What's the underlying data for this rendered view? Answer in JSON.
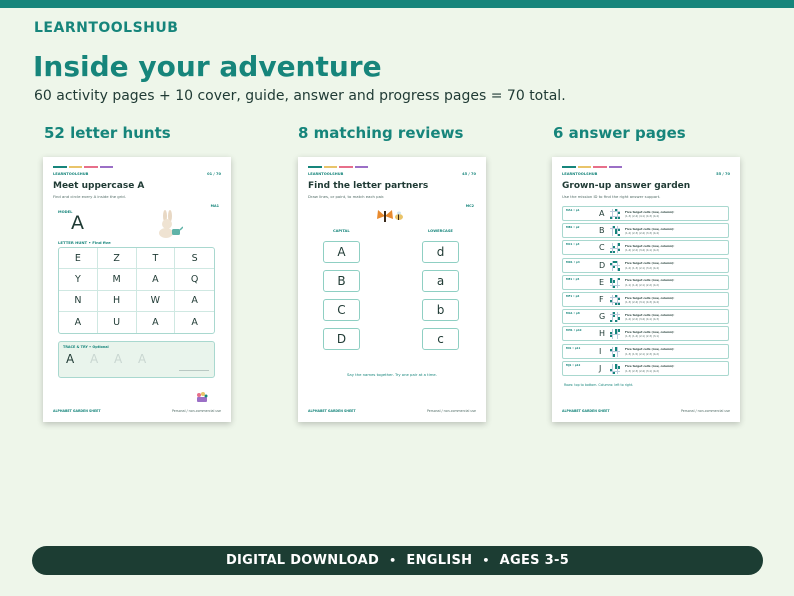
{
  "brand": "LEARNTOOLSHUB",
  "title": "Inside your adventure",
  "subtitle": "60 activity pages + 10 cover, guide, answer and progress pages = 70 total.",
  "columns": [
    {
      "heading": "52 letter hunts"
    },
    {
      "heading": "8 matching reviews"
    },
    {
      "heading": "6 answer pages"
    }
  ],
  "accent_bars": [
    "#16857b",
    "#e9c46a",
    "#e76f8a",
    "#9b6fc6"
  ],
  "sheet1": {
    "brand": "LEARNTOOLSHUB",
    "page": "01 / 70",
    "title": "Meet uppercase A",
    "sub": "Find and circle every A inside the grid.",
    "id": "MA1",
    "model_label": "MODEL",
    "model_letter": "A",
    "hunt_label": "LETTER HUNT  •  Find five",
    "grid": [
      "E",
      "Z",
      "T",
      "S",
      "Y",
      "M",
      "A",
      "Q",
      "N",
      "H",
      "W",
      "A",
      "A",
      "U",
      "A",
      "A"
    ],
    "trace_label": "TRACE & TRY  •  Optional",
    "trace_letters": [
      "A",
      "A",
      "A",
      "A"
    ],
    "foot_left": "ALPHABET GARDEN SHEET",
    "foot_right": "Personal / non-commercial use"
  },
  "sheet2": {
    "brand": "LEARNTOOLSHUB",
    "page": "45 / 70",
    "title": "Find the letter partners",
    "sub": "Draw lines, or point, to match each pair.",
    "id": "MC2",
    "capital_label": "CAPITAL",
    "lower_label": "LOWERCASE",
    "capitals": [
      "A",
      "B",
      "C",
      "D"
    ],
    "lowers": [
      "d",
      "a",
      "b",
      "c"
    ],
    "tip": "Say the names together. Try one pair at a time.",
    "foot_left": "ALPHABET GARDEN SHEET",
    "foot_right": "Personal / non-commercial use"
  },
  "sheet3": {
    "brand": "LEARNTOOLSHUB",
    "page": "55 / 70",
    "title": "Grown-up answer garden",
    "sub": "Use the mission ID to find the right answer support.",
    "rows": [
      {
        "id": "MA1 • p1",
        "letter": "A",
        "t1": "Five target cells (row, column):",
        "t2": "(1,3) (2,4) (4,1) (4,3) (4,4)"
      },
      {
        "id": "MB1 • p2",
        "letter": "B",
        "t1": "Five target cells (row, column):",
        "t2": "(1,2) (2,3) (2,4) (3,3) (4,4)"
      },
      {
        "id": "MC1 • p3",
        "letter": "C",
        "t1": "Five target cells (row, column):",
        "t2": "(1,4) (2,2) (3,4) (4,1) (4,2)"
      },
      {
        "id": "MD1 • p4",
        "letter": "D",
        "t1": "Five target cells (row, column):",
        "t2": "(1,2) (1,3) (2,1) (3,2) (4,4)"
      },
      {
        "id": "ME1 • p5",
        "letter": "E",
        "t1": "Five target cells (row, column):",
        "t2": "(1,1) (1,4) (2,1) (2,2) (4,2)"
      },
      {
        "id": "MF1 • p6",
        "letter": "F",
        "t1": "Five target cells (row, column):",
        "t2": "(1,3) (2,4) (3,1) (4,3) (4,4)"
      },
      {
        "id": "MG1 • p8",
        "letter": "G",
        "t1": "Five target cells (row, column):",
        "t2": "(1,2) (2,2) (3,4) (4,1) (4,3)"
      },
      {
        "id": "MH1 • p10",
        "letter": "H",
        "t1": "Five target cells (row, column):",
        "t2": "(1,3) (1,4) (2,1) (2,3) (3,1)"
      },
      {
        "id": "MI1 • p11",
        "letter": "I",
        "t1": "Five target cells (row, column):",
        "t2": "(1,3) (1,5) (2,1) (2,3) (4,2)"
      },
      {
        "id": "MJ1 • p12",
        "letter": "J",
        "t1": "Five target cells (row, column):",
        "t2": "(1,3) (2,3) (2,4) (3,1) (4,2)"
      }
    ],
    "note": "Rows: top to bottom. Columns: left to right.",
    "foot_left": "ALPHABET GARDEN SHEET",
    "foot_right": "Personal / non-commercial use"
  },
  "footer": {
    "items": [
      "DIGITAL DOWNLOAD",
      "ENGLISH",
      "AGES 3-5"
    ],
    "separator": "•"
  }
}
